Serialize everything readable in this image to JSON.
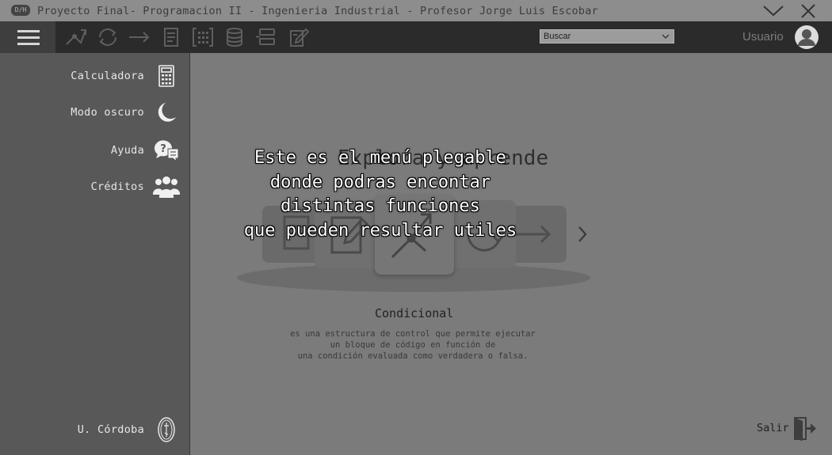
{
  "window": {
    "title": "Proyecto Final- Programacion II - Ingenieria Industrial - Profesor Jorge Luis Escobar",
    "logo_text": "D/H"
  },
  "toolbar": {
    "tools": [
      {
        "icon": "conditional-icon"
      },
      {
        "icon": "loop-icon"
      },
      {
        "icon": "arrow-right-icon"
      },
      {
        "icon": "document-icon"
      },
      {
        "icon": "matrix-icon"
      },
      {
        "icon": "database-icon"
      },
      {
        "icon": "list-icon"
      },
      {
        "icon": "edit-icon"
      }
    ],
    "search": {
      "selected": "Buscar"
    },
    "user": {
      "label": "Usuario"
    }
  },
  "sidebar": {
    "items": [
      {
        "label": "Calculadora",
        "icon": "calculator-icon"
      },
      {
        "label": "Modo oscuro",
        "icon": "moon-icon"
      },
      {
        "label": "Ayuda",
        "icon": "help-chat-icon"
      },
      {
        "label": "Créditos",
        "icon": "users-icon"
      }
    ],
    "footer": {
      "label": "U. Córdoba",
      "icon": "university-seal-icon"
    }
  },
  "main": {
    "heading": "Explora y aprende",
    "concept": {
      "title": "Condicional",
      "description": "es una estructura de control que permite ejecutar\nun bloque de código en función de\nuna condición evaluada como verdadera o falsa."
    },
    "exit_label": "Salir"
  },
  "overlay": {
    "text": "Este es el menú plegable\ndonde podras encontar\ndistintas funciones\nque pueden resultar utiles"
  }
}
